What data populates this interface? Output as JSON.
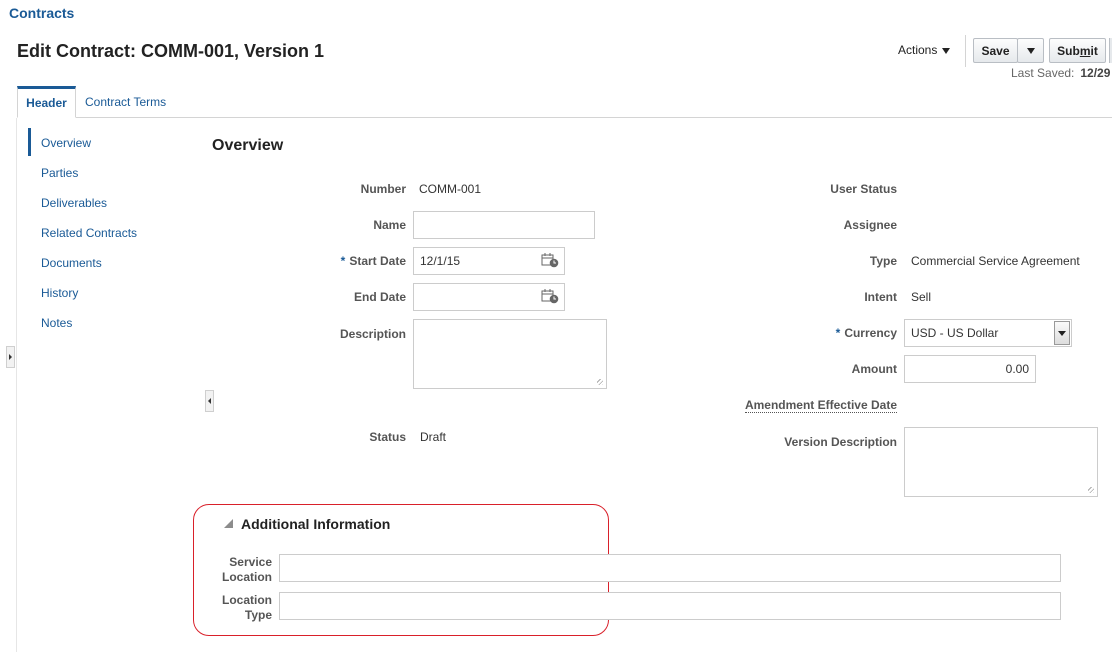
{
  "app": {
    "title": "Contracts"
  },
  "page": {
    "title": "Edit Contract: COMM-001, Version 1"
  },
  "toolbar": {
    "actions_label": "Actions",
    "save_label": "Save",
    "submit_prefix": "Sub",
    "submit_accel": "m",
    "submit_suffix": "it",
    "last_saved_label": "Last Saved:",
    "last_saved_value": "12/29"
  },
  "tabs": [
    {
      "label": "Header",
      "selected": true
    },
    {
      "label": "Contract Terms",
      "selected": false
    }
  ],
  "nav": {
    "items": [
      {
        "label": "Overview",
        "selected": true
      },
      {
        "label": "Parties"
      },
      {
        "label": "Deliverables"
      },
      {
        "label": "Related Contracts"
      },
      {
        "label": "Documents"
      },
      {
        "label": "History"
      },
      {
        "label": "Notes"
      }
    ]
  },
  "overview": {
    "title": "Overview",
    "number_label": "Number",
    "number_value": "COMM-001",
    "name_label": "Name",
    "name_value": "",
    "start_date_label": "Start Date",
    "start_date_value": "12/1/15",
    "end_date_label": "End Date",
    "end_date_value": "",
    "description_label": "Description",
    "description_value": "",
    "status_label": "Status",
    "status_value": "Draft",
    "user_status_label": "User Status",
    "assignee_label": "Assignee",
    "type_label": "Type",
    "type_value": "Commercial Service Agreement",
    "intent_label": "Intent",
    "intent_value": "Sell",
    "currency_label": "Currency",
    "currency_value": "USD - US Dollar",
    "amount_label": "Amount",
    "amount_value": "0.00",
    "amend_label": "Amendment Effective Date",
    "version_desc_label": "Version Description",
    "required_mark": "*"
  },
  "additional": {
    "title": "Additional Information",
    "service_location_label_1": "Service",
    "service_location_label_2": "Location",
    "location_type_label_1": "Location",
    "location_type_label_2": "Type"
  },
  "colors": {
    "accent": "#1a5a96",
    "highlight": "#d9202a"
  }
}
